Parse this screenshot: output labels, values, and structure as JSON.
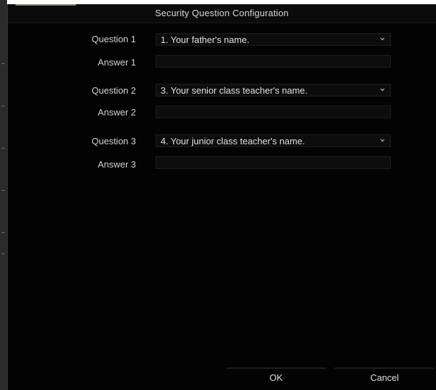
{
  "dialog": {
    "title": "Security Question Configuration"
  },
  "questions": [
    {
      "question_label": "Question 1",
      "selected_question": "1. Your father's name.",
      "answer_label": "Answer 1",
      "answer_value": ""
    },
    {
      "question_label": "Question 2",
      "selected_question": "3. Your senior class teacher's name.",
      "answer_label": "Answer 2",
      "answer_value": ""
    },
    {
      "question_label": "Question 3",
      "selected_question": "4. Your junior class teacher's name.",
      "answer_label": "Answer 3",
      "answer_value": ""
    }
  ],
  "buttons": {
    "ok_label": "OK",
    "cancel_label": "Cancel"
  },
  "icons": {
    "dropdown": "chevron-down-icon"
  },
  "colors": {
    "background": "#030303",
    "field": "#0d0d0d",
    "text": "#e0e0e0",
    "accent": "#8a8460"
  }
}
